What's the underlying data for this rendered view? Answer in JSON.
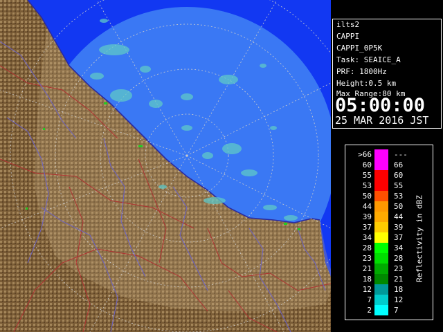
{
  "info": {
    "radar": "ilts2",
    "product": "CAPPI",
    "product_id": "CAPPI_0P5K",
    "task": "Task: SEAICE_A",
    "prf": "PRF: 1800Hz",
    "height": "Height:0.5 km",
    "max_range": "Max Range:80 km",
    "time": "05:00:00",
    "date": "25 MAR 2016 JST"
  },
  "legend": {
    "unit": "Reflectivity in dBZ",
    "bins": [
      {
        "low": ">66",
        "high": "---",
        "color": "#ff00ff"
      },
      {
        "low": "60",
        "high": "66",
        "color": "#ff00ff"
      },
      {
        "low": "55",
        "high": "60",
        "color": "#ff0000"
      },
      {
        "low": "53",
        "high": "55",
        "color": "#ff0000"
      },
      {
        "low": "50",
        "high": "53",
        "color": "#ff5000"
      },
      {
        "low": "44",
        "high": "50",
        "color": "#ff9900"
      },
      {
        "low": "39",
        "high": "44",
        "color": "#ffaa00"
      },
      {
        "low": "37",
        "high": "39",
        "color": "#ffcc00"
      },
      {
        "low": "34",
        "high": "37",
        "color": "#ffff00"
      },
      {
        "low": "28",
        "high": "34",
        "color": "#00ff00"
      },
      {
        "low": "23",
        "high": "28",
        "color": "#00dd00"
      },
      {
        "low": "21",
        "high": "23",
        "color": "#00aa00"
      },
      {
        "low": "18",
        "high": "21",
        "color": "#008800"
      },
      {
        "low": "12",
        "high": "18",
        "color": "#009999"
      },
      {
        "low": "7",
        "high": "12",
        "color": "#00cccc"
      },
      {
        "low": "2",
        "high": "7",
        "color": "#00ffff"
      }
    ]
  },
  "map": {
    "sea_color": "#1238f2",
    "range_disc_color": "#3a78f4",
    "land_color": "#8a6a40",
    "land_highlight": "#b8a070",
    "coastline_color": "#2a2aa0",
    "boundary_color": "#b03030",
    "river_color": "#6a62c8",
    "echo_color": "#5fc8c8"
  }
}
